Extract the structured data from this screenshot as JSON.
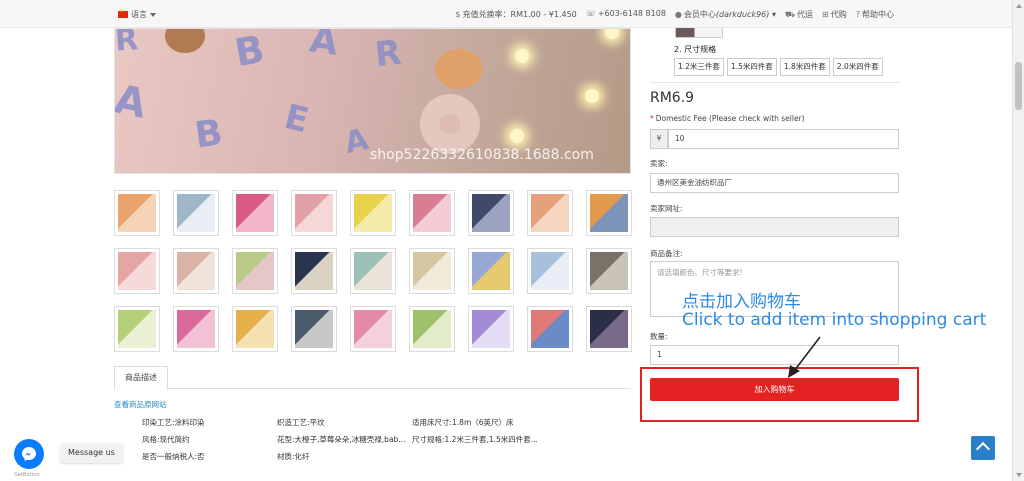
{
  "topbar": {
    "language": "语言",
    "exchange_label": "充值兑换率：",
    "exchange_value": "RM1.00 - ¥1.450",
    "phone": "+603-6148 8108",
    "member_center": "会员中心",
    "username": "(darkduck96)",
    "agent": "代运",
    "purchase": "代购",
    "help": "帮助中心"
  },
  "main_image": {
    "watermark": "shop5226332610838.1688.com",
    "letters": [
      "B",
      "A",
      "R",
      "A",
      "B",
      "E",
      "A",
      "R"
    ]
  },
  "thumbnails": [
    {
      "colors": [
        "#e9a26a",
        "#f3d2b5"
      ]
    },
    {
      "colors": [
        "#9fb6c8",
        "#e8eef3"
      ]
    },
    {
      "colors": [
        "#d85b86",
        "#f2b6c8"
      ]
    },
    {
      "colors": [
        "#e2a1a8",
        "#f4d7d6"
      ]
    },
    {
      "colors": [
        "#e7d249",
        "#f5eaa8"
      ]
    },
    {
      "colors": [
        "#d97d92",
        "#f3cbd4"
      ]
    },
    {
      "colors": [
        "#3f4a6a",
        "#9aa4c0"
      ]
    },
    {
      "colors": [
        "#e3a07a",
        "#f5d5c0"
      ]
    },
    {
      "colors": [
        "#e39a4a",
        "#7d93b8"
      ]
    },
    {
      "colors": [
        "#e6a5a5",
        "#f6dada"
      ]
    },
    {
      "colors": [
        "#d9b3a5",
        "#f1e2da"
      ]
    },
    {
      "colors": [
        "#b9c98a",
        "#e6c6c6"
      ]
    },
    {
      "colors": [
        "#2b3550",
        "#d9d2c2"
      ]
    },
    {
      "colors": [
        "#9cc0b8",
        "#e9e3d8"
      ]
    },
    {
      "colors": [
        "#d4c6a0",
        "#f2ead8"
      ]
    },
    {
      "colors": [
        "#96a9d6",
        "#e6c86e"
      ]
    },
    {
      "colors": [
        "#a8c0da",
        "#e9eef5"
      ]
    },
    {
      "colors": [
        "#7a7266",
        "#c9c2b6"
      ]
    },
    {
      "colors": [
        "#b6d07a",
        "#e9f0d4"
      ]
    },
    {
      "colors": [
        "#d96a9a",
        "#f2c2d6"
      ]
    },
    {
      "colors": [
        "#e6b04a",
        "#f6e2b0"
      ]
    },
    {
      "colors": [
        "#4a5a6a",
        "#c8c8c8"
      ]
    },
    {
      "colors": [
        "#e38aa6",
        "#f4d0dc"
      ]
    },
    {
      "colors": [
        "#9fc06a",
        "#e2ecc9"
      ]
    },
    {
      "colors": [
        "#a58ad6",
        "#e5ddf3"
      ]
    },
    {
      "colors": [
        "#e07a7a",
        "#6a8ac8"
      ]
    },
    {
      "colors": [
        "#2b2f45",
        "#7a6a8a"
      ]
    }
  ],
  "tabs": {
    "description": "商品描述"
  },
  "links": {
    "view_original": "查看商品原网站"
  },
  "attributes": [
    {
      "k": "印染工艺:",
      "v": "涂料印染"
    },
    {
      "k": "织造工艺:",
      "v": "平纹"
    },
    {
      "k": "适用床尺寸:",
      "v": "1.8m（6英尺）床"
    },
    {
      "k": "风格:",
      "v": "现代简约"
    },
    {
      "k": "花型:",
      "v": "大橙子,草莓朵朵,冰糖壳禄,bab..."
    },
    {
      "k": "尺寸规格:",
      "v": "1.2米三件套,1.5米四件套..."
    },
    {
      "k": "是否一般纳税人:",
      "v": "否"
    },
    {
      "k": "材质:",
      "v": "化纤"
    },
    {
      "k": "",
      "v": ""
    }
  ],
  "spec": {
    "label": "2. 尺寸规格",
    "options": [
      "1.2米三件套",
      "1.5米四件套",
      "1.8米四件套",
      "2.0米四件套"
    ]
  },
  "price": "RM6.9",
  "fields": {
    "domestic_fee_label": "Domestic Fee (Please check with seller)",
    "currency_addon": "¥",
    "domestic_fee_value": "10",
    "seller_label": "卖家:",
    "seller_value": "通州区美金油纺织品厂",
    "seller_url_label": "卖家网址:",
    "seller_url_value": "",
    "remarks_label": "商品备注:",
    "remarks_placeholder": "请选填颜色、尺寸等要求!",
    "quantity_label": "数量:",
    "quantity_value": "1"
  },
  "cart_button": "加入购物车",
  "annotation": {
    "cn": "点击加入购物车",
    "en": "Click to add item into shopping cart",
    "color": "#2b8ae6",
    "box_color": "#e52222"
  },
  "widgets": {
    "messenger_label": "Message us",
    "getbutton": "GetButton"
  }
}
